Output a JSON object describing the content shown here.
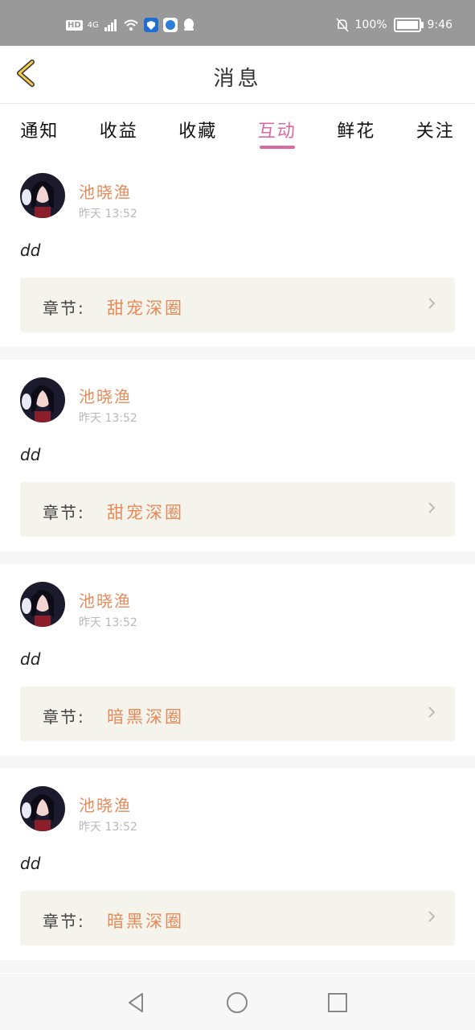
{
  "status_bar": {
    "hd": "HD",
    "network": "4G",
    "battery_text": "100%",
    "time": "9:46"
  },
  "header": {
    "title": "消息"
  },
  "tabs": [
    {
      "label": "通知"
    },
    {
      "label": "收益"
    },
    {
      "label": "收藏"
    },
    {
      "label": "互动"
    },
    {
      "label": "鲜花"
    },
    {
      "label": "关注"
    }
  ],
  "active_tab": "互动",
  "messages": [
    {
      "name": "池晓渔",
      "time": "昨天  13:52",
      "text": "dd",
      "chapter_label": "章节:",
      "chapter_title": "甜宠深圈"
    },
    {
      "name": "池晓渔",
      "time": "昨天  13:52",
      "text": "dd",
      "chapter_label": "章节:",
      "chapter_title": "甜宠深圈"
    },
    {
      "name": "池晓渔",
      "time": "昨天  13:52",
      "text": "dd",
      "chapter_label": "章节:",
      "chapter_title": "暗黑深圈"
    },
    {
      "name": "池晓渔",
      "time": "昨天  13:52",
      "text": "dd",
      "chapter_label": "章节:",
      "chapter_title": "暗黑深圈"
    }
  ],
  "colors": {
    "accent_pink": "#d96aa0",
    "accent_orange": "#e68a5a",
    "chapter_bg": "#f4f4ec"
  }
}
